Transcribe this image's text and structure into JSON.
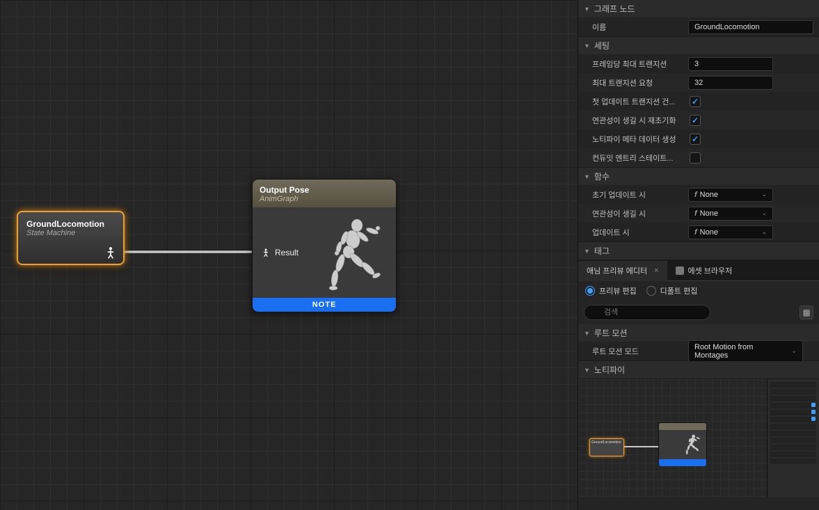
{
  "graph": {
    "state_node": {
      "title": "GroundLocomotion",
      "subtitle": "State Machine"
    },
    "output_node": {
      "title": "Output Pose",
      "subtitle": "AnimGraph",
      "result_label": "Result",
      "note": "NOTE"
    }
  },
  "details": {
    "sections": {
      "graph_node": "그래프 노드",
      "settings": "세팅",
      "functions": "함수",
      "tag": "태그",
      "root_motion": "루트 모션",
      "notify": "노티파이"
    },
    "rows": {
      "name_label": "이름",
      "name_value": "GroundLocomotion",
      "max_trans_per_frame_label": "프레임당 최대 트랜지션",
      "max_trans_per_frame_value": "3",
      "max_trans_req_label": "최대 트랜지션 요청",
      "max_trans_req_value": "32",
      "first_update_trans_label": "첫 업데이트 트랜지션 건...",
      "reinit_relevancy_label": "연관성이 생길 시 재초기화",
      "notify_meta_label": "노티파이 메타 데이터 생성",
      "conduit_entry_label": "컨듀잇 엔트리 스테이트...",
      "on_initial_update_label": "초기 업데이트 시",
      "on_become_relevant_label": "연관성이 생길 시",
      "on_update_label": "업데이트 시",
      "func_none": "None",
      "root_motion_mode_label": "루트 모션 모드",
      "root_motion_mode_value": "Root Motion from Montages"
    },
    "tabs": {
      "preview_editor": "애님 프리뷰 에디터",
      "asset_browser": "에셋 브라우저"
    },
    "radios": {
      "preview_edit": "프리뷰 편집",
      "default_edit": "디폴트 편집"
    },
    "search_placeholder": "검색"
  }
}
